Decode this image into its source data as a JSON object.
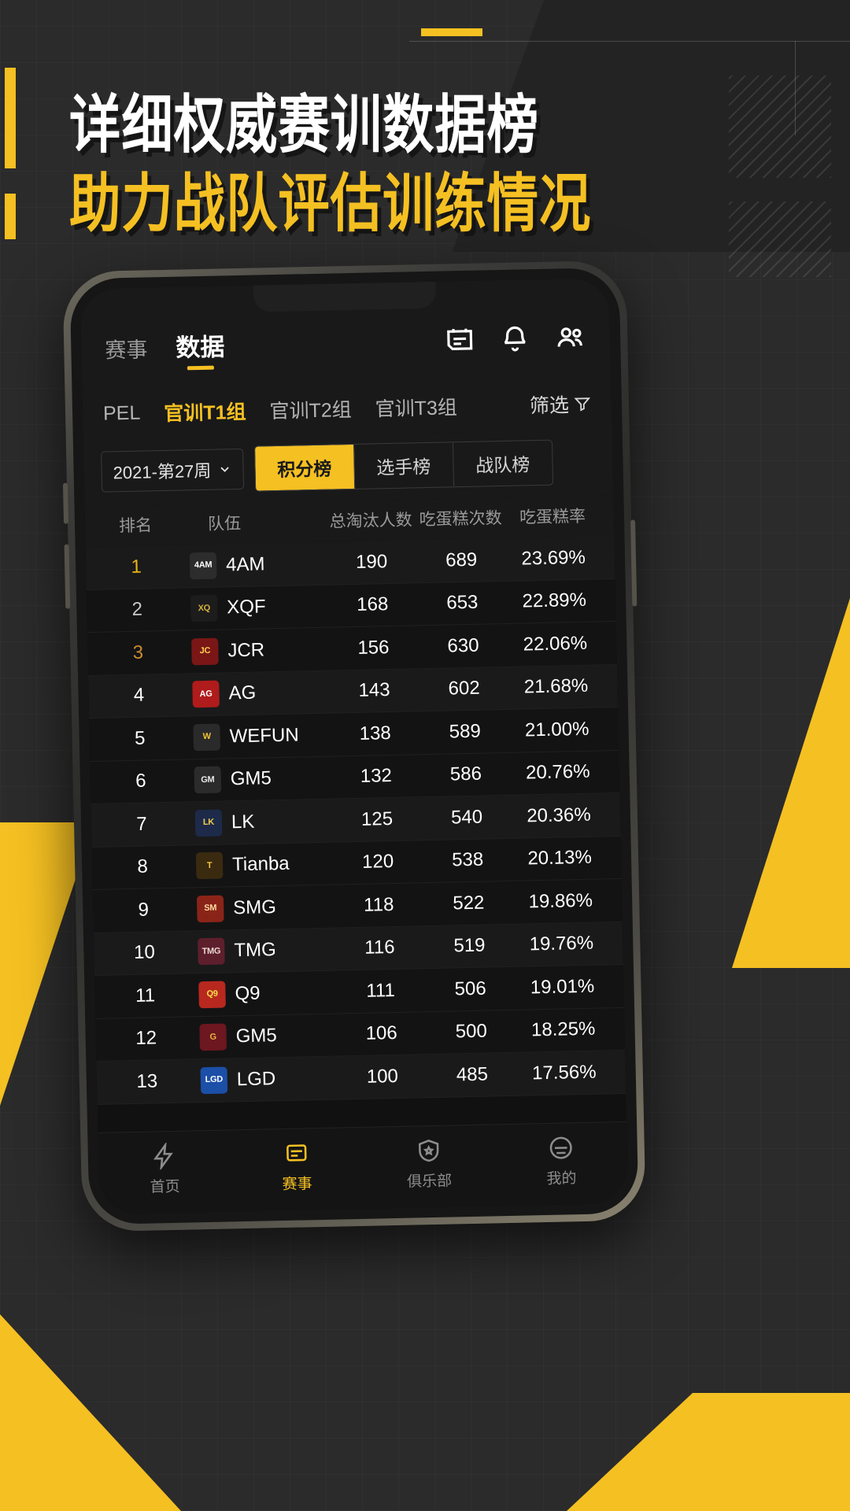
{
  "poster": {
    "headline_line1": "详细权威赛训数据榜",
    "headline_line2": "助力战队评估训练情况",
    "accent_color": "#F5C022",
    "bg_color": "#2b2b2b"
  },
  "app": {
    "header": {
      "tabs": [
        {
          "label": "赛事",
          "active": false
        },
        {
          "label": "数据",
          "active": true
        }
      ],
      "icons": [
        {
          "name": "calendar-icon"
        },
        {
          "name": "bell-icon"
        },
        {
          "name": "people-icon"
        }
      ]
    },
    "group_tabs": {
      "items": [
        {
          "label": "PEL",
          "active": false
        },
        {
          "label": "官训T1组",
          "active": true
        },
        {
          "label": "官训T2组",
          "active": false
        },
        {
          "label": "官训T3组",
          "active": false
        }
      ],
      "filter_label": "筛选"
    },
    "segment_row": {
      "week_value": "2021-第27周",
      "segments": [
        {
          "label": "积分榜",
          "active": true
        },
        {
          "label": "选手榜",
          "active": false
        },
        {
          "label": "战队榜",
          "active": false
        }
      ]
    },
    "table": {
      "headers": [
        "排名",
        "队伍",
        "总淘汰人数",
        "吃蛋糕次数",
        "吃蛋糕率"
      ],
      "rows": [
        {
          "rank": "1",
          "team": "4AM",
          "logo_text": "4AM",
          "logo_bg": "#2c2c2c",
          "logo_fg": "#ffffff",
          "kills": "190",
          "cakes": "689",
          "rate": "23.69%"
        },
        {
          "rank": "2",
          "team": "XQF",
          "logo_text": "XQ",
          "logo_bg": "#1c1c1c",
          "logo_fg": "#D8B040",
          "kills": "168",
          "cakes": "653",
          "rate": "22.89%"
        },
        {
          "rank": "3",
          "team": "JCR",
          "logo_text": "JC",
          "logo_bg": "#7a1616",
          "logo_fg": "#FFD34D",
          "kills": "156",
          "cakes": "630",
          "rate": "22.06%"
        },
        {
          "rank": "4",
          "team": "AG",
          "logo_text": "AG",
          "logo_bg": "#b01b1b",
          "logo_fg": "#ffffff",
          "kills": "143",
          "cakes": "602",
          "rate": "21.68%"
        },
        {
          "rank": "5",
          "team": "WEFUN",
          "logo_text": "W",
          "logo_bg": "#2a2a2a",
          "logo_fg": "#F0C537",
          "kills": "138",
          "cakes": "589",
          "rate": "21.00%"
        },
        {
          "rank": "6",
          "team": "GM5",
          "logo_text": "GM",
          "logo_bg": "#2b2b2b",
          "logo_fg": "#E8E8E8",
          "kills": "132",
          "cakes": "586",
          "rate": "20.76%"
        },
        {
          "rank": "7",
          "team": "LK",
          "logo_text": "LK",
          "logo_bg": "#1d2a4a",
          "logo_fg": "#F2D14A",
          "kills": "125",
          "cakes": "540",
          "rate": "20.36%"
        },
        {
          "rank": "8",
          "team": "Tianba",
          "logo_text": "T",
          "logo_bg": "#3a2a10",
          "logo_fg": "#F3C23B",
          "kills": "120",
          "cakes": "538",
          "rate": "20.13%"
        },
        {
          "rank": "9",
          "team": "SMG",
          "logo_text": "SM",
          "logo_bg": "#8a2418",
          "logo_fg": "#FFD9A0",
          "kills": "118",
          "cakes": "522",
          "rate": "19.86%"
        },
        {
          "rank": "10",
          "team": "TMG",
          "logo_text": "TMG",
          "logo_bg": "#5e1f2c",
          "logo_fg": "#E8D8D0",
          "kills": "116",
          "cakes": "519",
          "rate": "19.76%"
        },
        {
          "rank": "11",
          "team": "Q9",
          "logo_text": "Q9",
          "logo_bg": "#b8281f",
          "logo_fg": "#F5E14A",
          "kills": "111",
          "cakes": "506",
          "rate": "19.01%"
        },
        {
          "rank": "12",
          "team": "GM5",
          "logo_text": "G",
          "logo_bg": "#6d1720",
          "logo_fg": "#E8B63B",
          "kills": "106",
          "cakes": "500",
          "rate": "18.25%"
        },
        {
          "rank": "13",
          "team": "LGD",
          "logo_text": "LGD",
          "logo_bg": "#1b4fa8",
          "logo_fg": "#ffffff",
          "kills": "100",
          "cakes": "485",
          "rate": "17.56%"
        }
      ]
    },
    "bottom_nav": [
      {
        "label": "首页",
        "icon": "bolt-icon",
        "active": false
      },
      {
        "label": "赛事",
        "icon": "trophy-icon",
        "active": true
      },
      {
        "label": "俱乐部",
        "icon": "shield-icon",
        "active": false
      },
      {
        "label": "我的",
        "icon": "user-icon",
        "active": false
      }
    ]
  }
}
